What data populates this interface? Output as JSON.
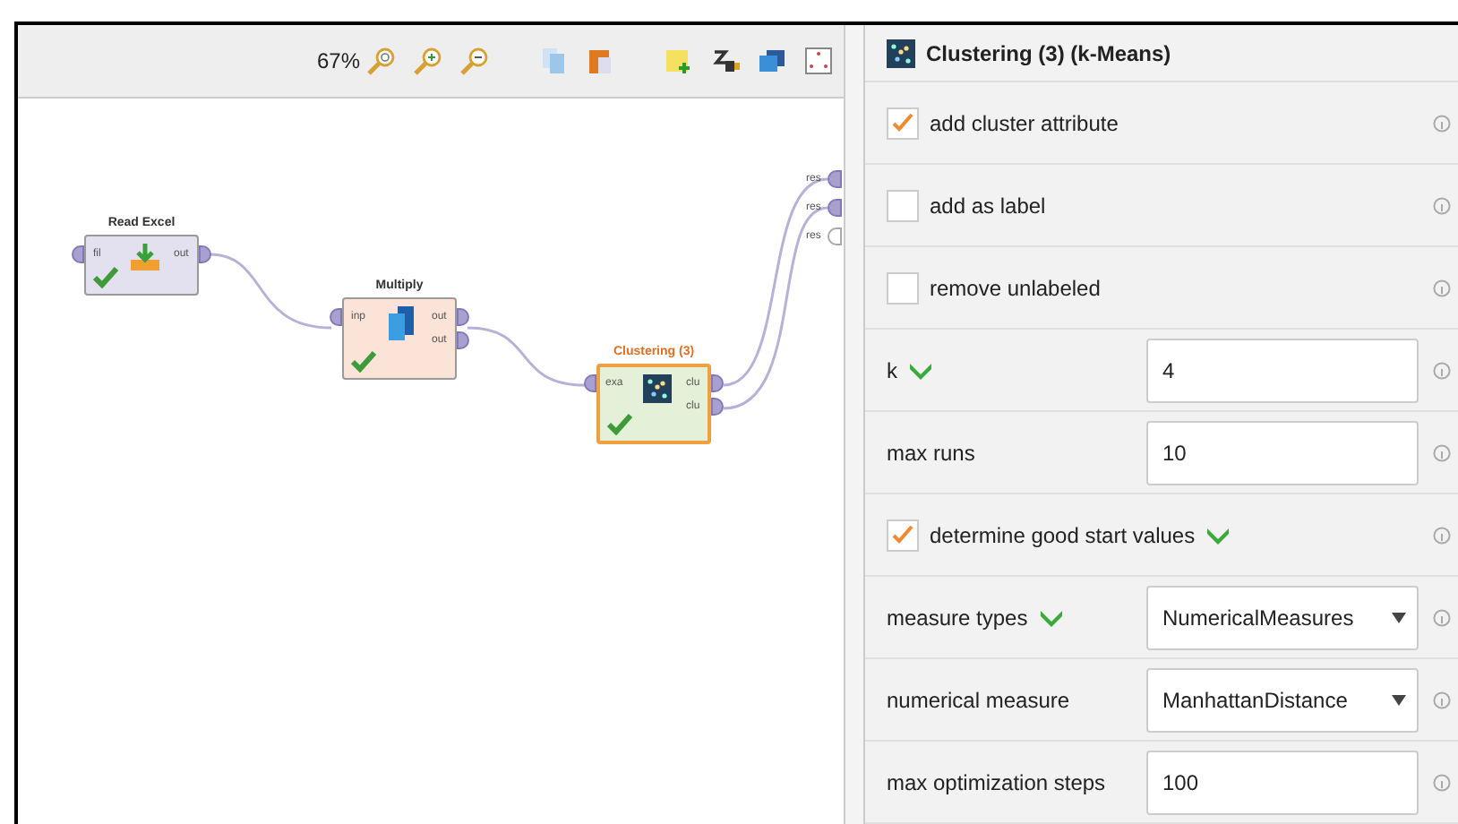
{
  "toolbar": {
    "zoom": "67%"
  },
  "canvas": {
    "nodes": [
      {
        "title": "Read Excel",
        "kind": "read",
        "selected": false,
        "ok": true,
        "inputs": [
          "fil"
        ],
        "outputs": [
          "out"
        ]
      },
      {
        "title": "Multiply",
        "kind": "multiply",
        "selected": false,
        "ok": true,
        "inputs": [
          "inp"
        ],
        "outputs": [
          "out",
          "out"
        ]
      },
      {
        "title": "Clustering (3)",
        "kind": "cluster",
        "selected": true,
        "ok": true,
        "inputs": [
          "exa"
        ],
        "outputs": [
          "clu",
          "clu"
        ]
      }
    ],
    "result_ports": [
      {
        "label": "res",
        "connected": true
      },
      {
        "label": "res",
        "connected": true
      },
      {
        "label": "res",
        "connected": false
      }
    ]
  },
  "panel": {
    "title": "Clustering (3) (k-Means)",
    "parameters": [
      {
        "kind": "checkbox",
        "label": "add cluster attribute",
        "checked": true,
        "marked": false
      },
      {
        "kind": "checkbox",
        "label": "add as label",
        "checked": false,
        "marked": false
      },
      {
        "kind": "checkbox",
        "label": "remove unlabeled",
        "checked": false,
        "marked": false
      },
      {
        "kind": "text",
        "label": "k",
        "value": "4",
        "marked": true
      },
      {
        "kind": "text",
        "label": "max runs",
        "value": "10",
        "marked": false
      },
      {
        "kind": "checkbox",
        "label": "determine good start values",
        "checked": true,
        "marked": true
      },
      {
        "kind": "select",
        "label": "measure types",
        "value": "NumericalMeasures",
        "marked": true
      },
      {
        "kind": "select",
        "label": "numerical measure",
        "value": "ManhattanDistance",
        "marked": false
      },
      {
        "kind": "text",
        "label": "max optimization steps",
        "value": "100",
        "marked": false
      }
    ]
  }
}
